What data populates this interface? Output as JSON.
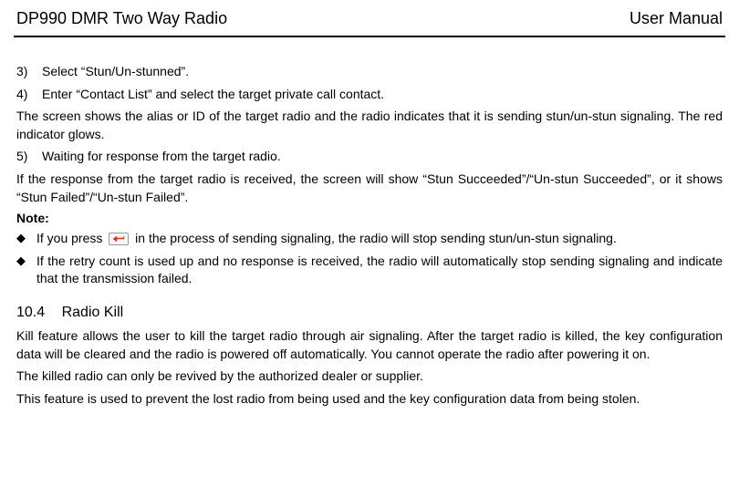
{
  "header": {
    "left": "DP990 DMR Two Way Radio",
    "right": "User Manual"
  },
  "items": {
    "step3_num": "3)",
    "step3_text": "Select “Stun/Un-stunned”.",
    "step4_num": "4)",
    "step4_text": "Enter “Contact List” and select the target private call contact.",
    "para1": "The screen shows the alias or ID of the target radio and the radio indicates that it is sending stun/un-stun signaling. The red indicator glows.",
    "step5_num": "5)",
    "step5_text": "Waiting for response from the target radio.",
    "para2": "If the response from the target radio is received, the screen will show “Stun Succeeded”/“Un-stun Succeeded”, or it shows “Stun Failed”/“Un-stun Failed”.",
    "note_label": "Note:",
    "bullet1_pre": "If you press ",
    "bullet1_post": " in the process of sending signaling, the radio will stop sending stun/un-stun signaling.",
    "bullet2": "If the retry count is used up and no response is received, the radio will automatically stop sending signaling and indicate that the transmission failed."
  },
  "section": {
    "num": "10.4",
    "title": "Radio Kill",
    "para1": "Kill feature allows the user to kill the target radio through air signaling. After the target radio is killed, the key configuration data will be cleared and the radio is powered off automatically. You cannot operate the radio after powering it on.",
    "para2": "The killed radio can only be revived by the authorized dealer or supplier.",
    "para3": "This feature is used to prevent the lost radio from being used and the key configuration data from being stolen."
  },
  "icons": {
    "back_key": "back-key-icon"
  }
}
